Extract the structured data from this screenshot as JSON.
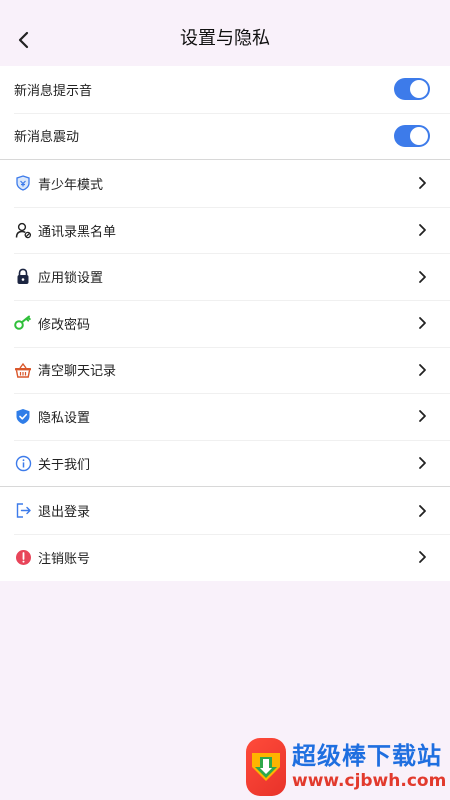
{
  "header": {
    "title": "设置与隐私"
  },
  "notifications": [
    {
      "label": "新消息提示音",
      "on": true
    },
    {
      "label": "新消息震动",
      "on": true
    }
  ],
  "settings": [
    {
      "label": "青少年模式",
      "icon": "teen-shield-icon"
    },
    {
      "label": "通讯录黑名单",
      "icon": "blacklist-user-icon"
    },
    {
      "label": "应用锁设置",
      "icon": "lock-icon"
    },
    {
      "label": "修改密码",
      "icon": "key-icon"
    },
    {
      "label": "清空聊天记录",
      "icon": "basket-icon"
    },
    {
      "label": "隐私设置",
      "icon": "privacy-shield-icon"
    },
    {
      "label": "关于我们",
      "icon": "info-icon"
    }
  ],
  "account": [
    {
      "label": "退出登录",
      "icon": "logout-icon"
    },
    {
      "label": "注销账号",
      "icon": "warning-icon"
    }
  ],
  "watermark": {
    "title": "超级棒下载站",
    "url": "www.cjbwh.com"
  },
  "colors": {
    "accent": "#3d7bea",
    "background": "#f9f1fa"
  }
}
